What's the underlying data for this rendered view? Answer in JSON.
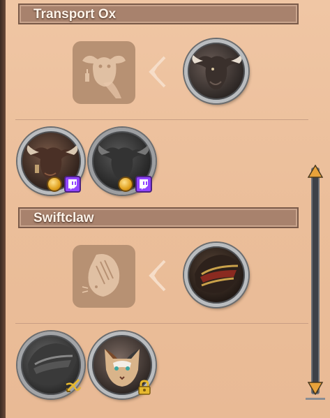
{
  "sections": [
    {
      "title": "Transport Ox",
      "silhouette_icon": "ox-silhouette-icon",
      "result_icon": "ox-mount-icon",
      "variants": [
        {
          "icon": "ox-variant-brown-icon",
          "badges": [
            "gold-coin-icon",
            "twitch-icon"
          ]
        },
        {
          "icon": "ox-variant-black-icon",
          "badges": [
            "gold-coin-icon",
            "twitch-icon"
          ]
        }
      ]
    },
    {
      "title": "Swiftclaw",
      "silhouette_icon": "swiftclaw-silhouette-icon",
      "result_icon": "swiftclaw-saddle-icon",
      "variants": [
        {
          "icon": "swiftclaw-saddle-grey-icon",
          "badges": [
            "crossbow-gold-icon"
          ]
        },
        {
          "icon": "swiftclaw-calico-icon",
          "badges": [
            "gold-lock-icon"
          ]
        }
      ]
    }
  ],
  "colors": {
    "panel_bg": "#efc4a1",
    "header_bg": "#a8826d",
    "header_text": "#fff4ea",
    "twitch_purple": "#9146ff",
    "coin_gold": "#e0a11e",
    "scrollbar_arrow": "#e8a23a"
  }
}
